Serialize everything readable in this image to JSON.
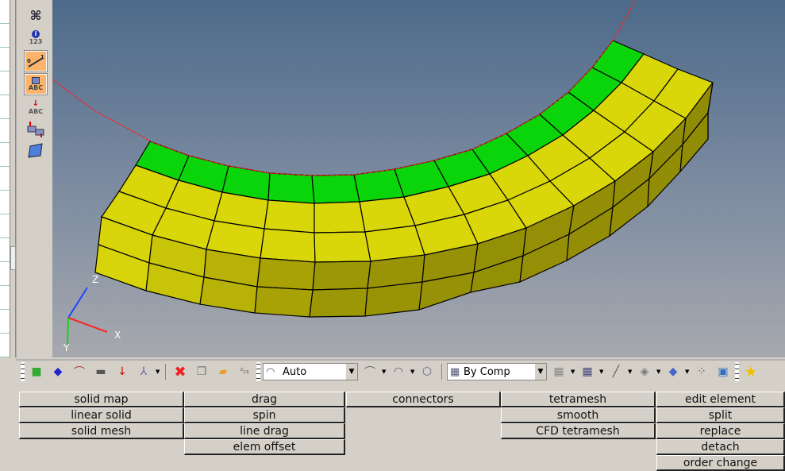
{
  "left_toolbar": {
    "items": [
      {
        "icon": "find-icon"
      },
      {
        "icon": "info-icon",
        "label": "123"
      },
      {
        "icon": "numbers-scale-icon",
        "active": true
      },
      {
        "icon": "label-abc-icon",
        "active": true,
        "label": "ABC"
      },
      {
        "icon": "arrow-abc-icon",
        "label": "ABC"
      },
      {
        "icon": "reorder-icon"
      },
      {
        "icon": "surface-icon"
      }
    ]
  },
  "viewport": {
    "axis_labels": {
      "x": "X",
      "y": "Y",
      "z": "Z"
    },
    "colors": {
      "selected": "#0ad40a",
      "elements": "#d9d60a",
      "curve": "#ff2020"
    }
  },
  "toolbar": {
    "geom_mode": "Auto",
    "elem_color_mode": "By Comp"
  },
  "panel": {
    "col1": [
      "solid map",
      "linear solid",
      "solid mesh"
    ],
    "col2": [
      "drag",
      "spin",
      "line drag",
      "elem offset"
    ],
    "col3": [
      "connectors"
    ],
    "col4": [
      "tetramesh",
      "smooth",
      "CFD tetramesh"
    ],
    "col5": [
      "edit element",
      "split",
      "replace",
      "detach",
      "order change"
    ]
  }
}
